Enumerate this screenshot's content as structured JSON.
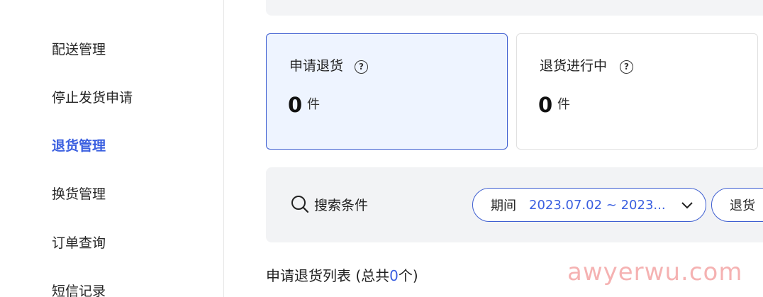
{
  "sidebar": {
    "items": [
      {
        "label": "配送管理",
        "active": false
      },
      {
        "label": "停止发货申请",
        "active": false
      },
      {
        "label": "退货管理",
        "active": true
      },
      {
        "label": "换货管理",
        "active": false
      },
      {
        "label": "订单查询",
        "active": false
      },
      {
        "label": "短信记录",
        "active": false
      }
    ]
  },
  "cards": [
    {
      "title": "申请退货",
      "count": "0",
      "unit": "件",
      "active": true
    },
    {
      "title": "退货进行中",
      "count": "0",
      "unit": "件",
      "active": false
    }
  ],
  "search": {
    "label": "搜索条件",
    "period_label": "期间",
    "period_value": "2023.07.02 ~ 2023...",
    "status_label": "退货"
  },
  "list": {
    "title": "申请退货列表 (总共",
    "count": "0",
    "suffix": "个)"
  },
  "colors": {
    "accent": "#3a5fe0",
    "active_card_bg": "#eef4ff",
    "panel_bg": "#f2f3f5"
  },
  "icons": {
    "help": "help-circle-icon",
    "search": "search-icon",
    "chevron": "chevron-down-icon"
  },
  "watermark": "awyerwu.com"
}
